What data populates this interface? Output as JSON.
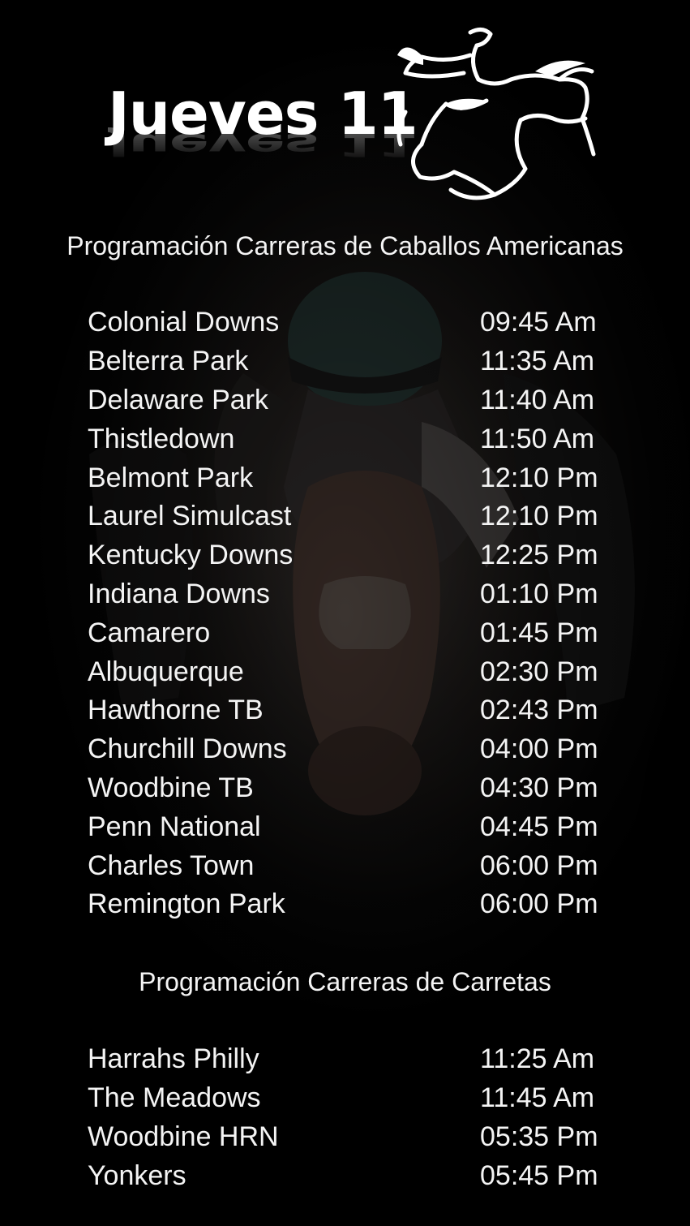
{
  "header": {
    "title": "Jueves 11",
    "logo": "horse-jumping-jockey-icon"
  },
  "sections": [
    {
      "heading": "Programación Carreras de Caballos Americanas",
      "races": [
        {
          "track": "Colonial Downs",
          "time": "09:45 Am"
        },
        {
          "track": "Belterra Park",
          "time": "11:35 Am"
        },
        {
          "track": "Delaware Park",
          "time": "11:40 Am"
        },
        {
          "track": "Thistledown",
          "time": "11:50 Am"
        },
        {
          "track": "Belmont Park",
          "time": "12:10 Pm"
        },
        {
          "track": "Laurel Simulcast",
          "time": "12:10 Pm"
        },
        {
          "track": "Kentucky Downs",
          "time": "12:25 Pm"
        },
        {
          "track": "Indiana Downs",
          "time": "01:10 Pm"
        },
        {
          "track": "Camarero",
          "time": "01:45 Pm"
        },
        {
          "track": "Albuquerque",
          "time": "02:30 Pm"
        },
        {
          "track": "Hawthorne TB",
          "time": "02:43 Pm"
        },
        {
          "track": "Churchill Downs",
          "time": "04:00 Pm"
        },
        {
          "track": "Woodbine TB",
          "time": "04:30 Pm"
        },
        {
          "track": "Penn National",
          "time": "04:45 Pm"
        },
        {
          "track": "Charles Town",
          "time": "06:00 Pm"
        },
        {
          "track": "Remington Park",
          "time": "06:00 Pm"
        }
      ]
    },
    {
      "heading": "Programación Carreras de Carretas",
      "races": [
        {
          "track": "Harrahs Philly",
          "time": "11:25 Am"
        },
        {
          "track": "The Meadows",
          "time": "11:45 Am"
        },
        {
          "track": "Woodbine HRN",
          "time": "05:35 Pm"
        },
        {
          "track": "Yonkers",
          "time": "05:45 Pm"
        }
      ]
    }
  ],
  "colors": {
    "background": "#000000",
    "text": "#f4f4f4"
  }
}
